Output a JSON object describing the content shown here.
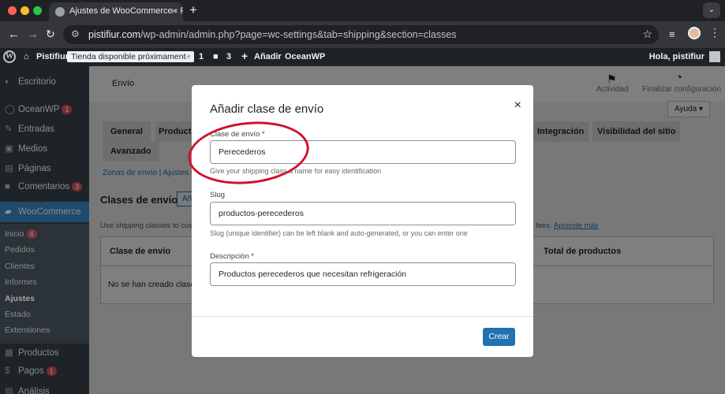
{
  "browser": {
    "tab_title": "Ajustes de WooCommerce ‹ P",
    "tab_close": "×",
    "new_tab": "+",
    "url_host": "pistifiur.com",
    "url_path": "/wp-admin/admin.php?page=wc-settings&tab=shipping&section=classes"
  },
  "adminbar": {
    "site": "Pistifiur",
    "tienda": "Tienda disponible próximamente",
    "updates": "1",
    "comments": "3",
    "add": "Añadir",
    "theme": "OceanWP",
    "greeting": "Hola, pistifiur"
  },
  "sidebar": {
    "items": [
      {
        "label": "Escritorio"
      },
      {
        "label": "OceanWP",
        "badge": "1"
      },
      {
        "label": "Entradas"
      },
      {
        "label": "Medios"
      },
      {
        "label": "Páginas"
      },
      {
        "label": "Comentarios",
        "badge": "3"
      },
      {
        "label": "WooCommerce"
      }
    ],
    "sub": [
      {
        "label": "Inicio",
        "badge": "4"
      },
      {
        "label": "Pedidos"
      },
      {
        "label": "Clientes"
      },
      {
        "label": "Informes"
      },
      {
        "label": "Ajustes"
      },
      {
        "label": "Estado"
      },
      {
        "label": "Extensiones"
      }
    ],
    "bottom": [
      {
        "label": "Productos"
      },
      {
        "label": "Pagos",
        "badge": "1"
      },
      {
        "label": "Análisis"
      }
    ]
  },
  "page": {
    "section": "Envío",
    "actividad": "Actividad",
    "finalizar": "Finalizar configuración",
    "ayuda": "Ayuda ▾",
    "tabs": [
      "General",
      "Producto",
      "Integración",
      "Visibilidad del sitio",
      "Avanzado"
    ],
    "subnav": "Zonas de envío | Ajustes d",
    "heading": "Clases de envío",
    "add_short": "Añ",
    "desc": "Use shipping classes to cus",
    "desc_end": "fees.",
    "learn": "Aprende más",
    "col_class": "Clase de envío",
    "col_total": "Total de productos",
    "empty": "No se han creado clases"
  },
  "modal": {
    "title": "Añadir clase de envío",
    "close": "×",
    "name_label": "Clase de envío *",
    "name_value": "Perecederos",
    "name_help": "Give your shipping class a name for easy identification",
    "slug_label": "Slug",
    "slug_value": "productos-perecederos",
    "slug_help": "Slug (unique identifier) can be left blank and auto-generated, or you can enter one",
    "desc_label": "Descripción *",
    "desc_value": "Productos perecederos que necesitan refrigeración",
    "submit": "Crear"
  }
}
